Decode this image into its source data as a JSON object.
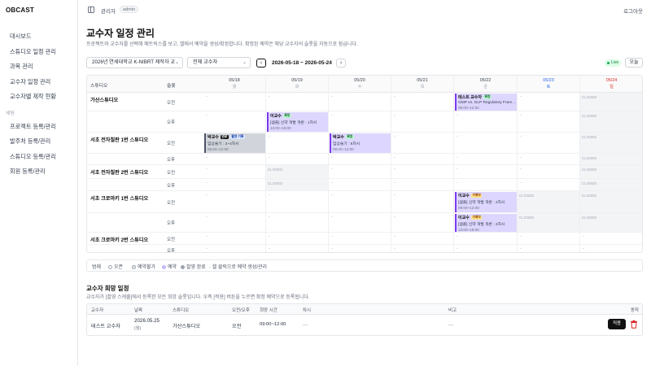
{
  "app": {
    "logo": "OBCAST"
  },
  "sidebar": {
    "items": [
      {
        "label": "대시보드"
      },
      {
        "label": "스튜디오 일정 관리"
      },
      {
        "label": "과목 관리"
      },
      {
        "label": "교수자 일정 관리"
      },
      {
        "label": "교수자별 제작 현황"
      }
    ],
    "section": "세팅",
    "settings": [
      {
        "label": "프로젝트 등록/관리"
      },
      {
        "label": "발주처 등록/관리"
      },
      {
        "label": "스튜디오 등록/관리"
      },
      {
        "label": "회원 등록/관리"
      }
    ]
  },
  "topbar": {
    "role": "관리자",
    "role_badge": "admin",
    "logout": "로그아웃"
  },
  "page": {
    "title": "교수자 일정 관리",
    "description": "프로젝트와 교수자를 선택해 매트릭스를 보고, 셀에서 예약을 생성/확정합니다. 확정된 예약은 해당 교수자의 슬롯을 자동으로 잠급니다."
  },
  "filters": {
    "project": "2026년 연세대학교 K-NIBRT 제작자 교",
    "professor": "전체 교수자",
    "prev": "‹",
    "next": "›",
    "range": "2026-05-18 ~ 2026-05-24",
    "live": "Live",
    "today": "오늘"
  },
  "calendar": {
    "col_studio": "스튜디오",
    "col_slot": "슬롯",
    "days": [
      {
        "date": "05/18",
        "wd": "월"
      },
      {
        "date": "05/19",
        "wd": "화"
      },
      {
        "date": "05/20",
        "wd": "수"
      },
      {
        "date": "05/21",
        "wd": "목"
      },
      {
        "date": "05/22",
        "wd": "금"
      },
      {
        "date": "05/23",
        "wd": "토"
      },
      {
        "date": "05/24",
        "wd": "일"
      }
    ],
    "studios": [
      {
        "name": "가산스튜디오",
        "slots": [
          "오전",
          "오후"
        ]
      },
      {
        "name": "서초 전자칠판 1번 스튜디오",
        "slots": [
          "오전",
          "오후"
        ]
      },
      {
        "name": "서초 전자칠판 2번 스튜디오",
        "slots": [
          "오전",
          "오후"
        ]
      },
      {
        "name": "서초 크로마키 1번 스튜디오",
        "slots": [
          "오전",
          "오후"
        ]
      },
      {
        "name": "서초 크로마키 2번 스튜디오",
        "slots": [
          "오전",
          "오후"
        ]
      }
    ],
    "empty": "-",
    "closed": "CLOSED",
    "events": {
      "e1": {
        "name": "테스트 교수자",
        "tag": "확정",
        "course": "GMP vs. GLP Regulatory Fram…",
        "time": "09:00~12:00"
      },
      "e2": {
        "name": "이교수",
        "tag": "확정",
        "course": "[샘플] 신약 개발 개론 : 1차시",
        "time": "13:00~18:00"
      },
      "e3": {
        "name": "박교수",
        "tag": "완료",
        "tag2": "촬영 기록",
        "course": "임상술기 : 3~4차시",
        "time": "09:00~12:00"
      },
      "e4": {
        "name": "박교수",
        "tag": "확정",
        "course": "임상술기 : 5차시",
        "time": "09:00~12:00"
      },
      "e5": {
        "name": "이교수",
        "tag": "가예약",
        "course": "[샘플] 신약 개발 개론 : 2차시",
        "time": "09:00~12:00"
      },
      "e6": {
        "name": "이교수",
        "tag": "가예약",
        "course": "[샘플] 신약 개발 개론 : 2차시",
        "time": "13:00~18:00"
      }
    }
  },
  "legend": {
    "title": "범례",
    "open": "오픈",
    "reserve": "예약불가",
    "confirm": "예약",
    "record": "촬영 완료",
    "hint": "· 셀 클릭으로 예약 생성/관리"
  },
  "wish": {
    "title": "교수자 희망 일정",
    "description": "교수자가 [촬영 스케줄]에서 등록한 모든 희망 슬롯입니다. 우측 [적용] 버튼을 누르면 확정 예약으로 등록됩니다.",
    "headers": {
      "prof": "교수자",
      "date": "날짜",
      "studio": "스튜디오",
      "ampm": "오전/오후",
      "time": "희망 시간",
      "course": "차시",
      "note": "비고",
      "action": "동작"
    },
    "rows": [
      {
        "prof": "테스트 교수자",
        "date": "2026.05.25",
        "weekday": "(월)",
        "studio": "가산스튜디오",
        "ampm": "오전",
        "time": "09:00~12:00",
        "course": "—",
        "note": "—",
        "apply": "적용"
      }
    ]
  }
}
